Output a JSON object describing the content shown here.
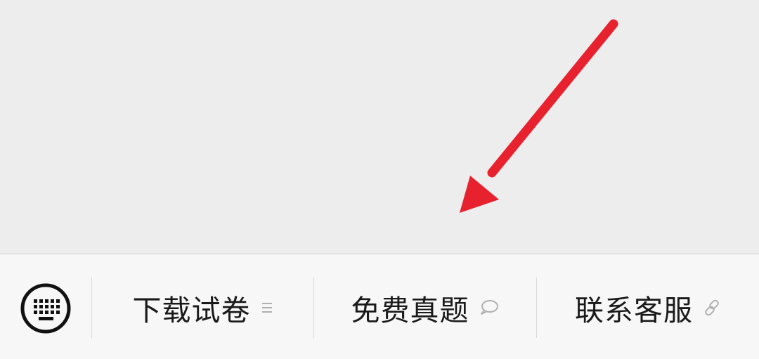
{
  "menu": {
    "keyboard_icon": "keyboard-icon",
    "items": [
      {
        "label": "下载试卷",
        "icon": "list-icon"
      },
      {
        "label": "免费真题",
        "icon": "chat-bubble-icon"
      },
      {
        "label": "联系客服",
        "icon": "link-icon"
      }
    ]
  },
  "annotation": {
    "arrow_color": "#e8212e"
  },
  "colors": {
    "chat_background": "#ededed",
    "menu_background": "#f7f7f7",
    "text": "#1a1a1a",
    "icon_gray": "#b0b0b0"
  }
}
